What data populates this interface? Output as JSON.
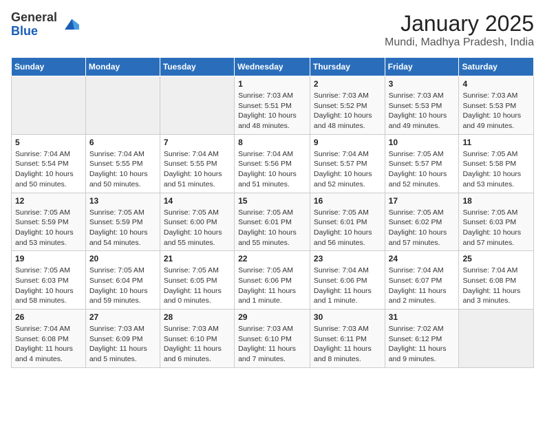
{
  "logo": {
    "general": "General",
    "blue": "Blue"
  },
  "header": {
    "month": "January 2025",
    "location": "Mundi, Madhya Pradesh, India"
  },
  "weekdays": [
    "Sunday",
    "Monday",
    "Tuesday",
    "Wednesday",
    "Thursday",
    "Friday",
    "Saturday"
  ],
  "weeks": [
    [
      {
        "day": "",
        "info": ""
      },
      {
        "day": "",
        "info": ""
      },
      {
        "day": "",
        "info": ""
      },
      {
        "day": "1",
        "info": "Sunrise: 7:03 AM\nSunset: 5:51 PM\nDaylight: 10 hours\nand 48 minutes."
      },
      {
        "day": "2",
        "info": "Sunrise: 7:03 AM\nSunset: 5:52 PM\nDaylight: 10 hours\nand 48 minutes."
      },
      {
        "day": "3",
        "info": "Sunrise: 7:03 AM\nSunset: 5:53 PM\nDaylight: 10 hours\nand 49 minutes."
      },
      {
        "day": "4",
        "info": "Sunrise: 7:03 AM\nSunset: 5:53 PM\nDaylight: 10 hours\nand 49 minutes."
      }
    ],
    [
      {
        "day": "5",
        "info": "Sunrise: 7:04 AM\nSunset: 5:54 PM\nDaylight: 10 hours\nand 50 minutes."
      },
      {
        "day": "6",
        "info": "Sunrise: 7:04 AM\nSunset: 5:55 PM\nDaylight: 10 hours\nand 50 minutes."
      },
      {
        "day": "7",
        "info": "Sunrise: 7:04 AM\nSunset: 5:55 PM\nDaylight: 10 hours\nand 51 minutes."
      },
      {
        "day": "8",
        "info": "Sunrise: 7:04 AM\nSunset: 5:56 PM\nDaylight: 10 hours\nand 51 minutes."
      },
      {
        "day": "9",
        "info": "Sunrise: 7:04 AM\nSunset: 5:57 PM\nDaylight: 10 hours\nand 52 minutes."
      },
      {
        "day": "10",
        "info": "Sunrise: 7:05 AM\nSunset: 5:57 PM\nDaylight: 10 hours\nand 52 minutes."
      },
      {
        "day": "11",
        "info": "Sunrise: 7:05 AM\nSunset: 5:58 PM\nDaylight: 10 hours\nand 53 minutes."
      }
    ],
    [
      {
        "day": "12",
        "info": "Sunrise: 7:05 AM\nSunset: 5:59 PM\nDaylight: 10 hours\nand 53 minutes."
      },
      {
        "day": "13",
        "info": "Sunrise: 7:05 AM\nSunset: 5:59 PM\nDaylight: 10 hours\nand 54 minutes."
      },
      {
        "day": "14",
        "info": "Sunrise: 7:05 AM\nSunset: 6:00 PM\nDaylight: 10 hours\nand 55 minutes."
      },
      {
        "day": "15",
        "info": "Sunrise: 7:05 AM\nSunset: 6:01 PM\nDaylight: 10 hours\nand 55 minutes."
      },
      {
        "day": "16",
        "info": "Sunrise: 7:05 AM\nSunset: 6:01 PM\nDaylight: 10 hours\nand 56 minutes."
      },
      {
        "day": "17",
        "info": "Sunrise: 7:05 AM\nSunset: 6:02 PM\nDaylight: 10 hours\nand 57 minutes."
      },
      {
        "day": "18",
        "info": "Sunrise: 7:05 AM\nSunset: 6:03 PM\nDaylight: 10 hours\nand 57 minutes."
      }
    ],
    [
      {
        "day": "19",
        "info": "Sunrise: 7:05 AM\nSunset: 6:03 PM\nDaylight: 10 hours\nand 58 minutes."
      },
      {
        "day": "20",
        "info": "Sunrise: 7:05 AM\nSunset: 6:04 PM\nDaylight: 10 hours\nand 59 minutes."
      },
      {
        "day": "21",
        "info": "Sunrise: 7:05 AM\nSunset: 6:05 PM\nDaylight: 11 hours\nand 0 minutes."
      },
      {
        "day": "22",
        "info": "Sunrise: 7:05 AM\nSunset: 6:06 PM\nDaylight: 11 hours\nand 1 minute."
      },
      {
        "day": "23",
        "info": "Sunrise: 7:04 AM\nSunset: 6:06 PM\nDaylight: 11 hours\nand 1 minute."
      },
      {
        "day": "24",
        "info": "Sunrise: 7:04 AM\nSunset: 6:07 PM\nDaylight: 11 hours\nand 2 minutes."
      },
      {
        "day": "25",
        "info": "Sunrise: 7:04 AM\nSunset: 6:08 PM\nDaylight: 11 hours\nand 3 minutes."
      }
    ],
    [
      {
        "day": "26",
        "info": "Sunrise: 7:04 AM\nSunset: 6:08 PM\nDaylight: 11 hours\nand 4 minutes."
      },
      {
        "day": "27",
        "info": "Sunrise: 7:03 AM\nSunset: 6:09 PM\nDaylight: 11 hours\nand 5 minutes."
      },
      {
        "day": "28",
        "info": "Sunrise: 7:03 AM\nSunset: 6:10 PM\nDaylight: 11 hours\nand 6 minutes."
      },
      {
        "day": "29",
        "info": "Sunrise: 7:03 AM\nSunset: 6:10 PM\nDaylight: 11 hours\nand 7 minutes."
      },
      {
        "day": "30",
        "info": "Sunrise: 7:03 AM\nSunset: 6:11 PM\nDaylight: 11 hours\nand 8 minutes."
      },
      {
        "day": "31",
        "info": "Sunrise: 7:02 AM\nSunset: 6:12 PM\nDaylight: 11 hours\nand 9 minutes."
      },
      {
        "day": "",
        "info": ""
      }
    ]
  ]
}
